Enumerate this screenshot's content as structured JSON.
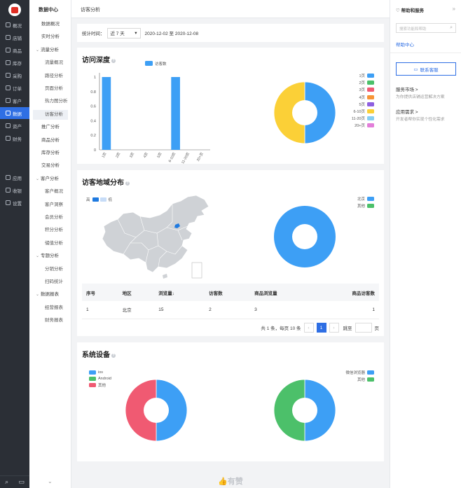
{
  "nav": {
    "items": [
      {
        "label": "概况",
        "icon": "dashboard-icon"
      },
      {
        "label": "店铺",
        "icon": "shop-icon"
      },
      {
        "label": "商品",
        "icon": "tag-icon"
      },
      {
        "label": "库存",
        "icon": "inventory-icon"
      },
      {
        "label": "采购",
        "icon": "purchase-icon"
      },
      {
        "label": "订单",
        "icon": "order-icon"
      },
      {
        "label": "客户",
        "icon": "customer-icon"
      },
      {
        "label": "数据",
        "icon": "chart-icon"
      },
      {
        "label": "资产",
        "icon": "asset-icon"
      },
      {
        "label": "财务",
        "icon": "finance-icon"
      }
    ],
    "items2": [
      {
        "label": "应用",
        "icon": "apps-icon"
      },
      {
        "label": "收银",
        "icon": "cashier-icon"
      },
      {
        "label": "设置",
        "icon": "settings-icon"
      }
    ]
  },
  "submenu": {
    "title": "数据中心",
    "items": [
      {
        "label": "数据概况",
        "type": "lvl1"
      },
      {
        "label": "实时分析",
        "type": "lvl1"
      },
      {
        "label": "流量分析",
        "type": "group"
      },
      {
        "label": "流量概况",
        "type": "lvl2"
      },
      {
        "label": "路径分析",
        "type": "lvl2"
      },
      {
        "label": "页面分析",
        "type": "lvl2"
      },
      {
        "label": "热力图分析",
        "type": "lvl2"
      },
      {
        "label": "访客分析",
        "type": "lvl2"
      },
      {
        "label": "推广分析",
        "type": "lvl1"
      },
      {
        "label": "商品分析",
        "type": "lvl1"
      },
      {
        "label": "库存分析",
        "type": "lvl1"
      },
      {
        "label": "交易分析",
        "type": "lvl1"
      },
      {
        "label": "客户分析",
        "type": "group"
      },
      {
        "label": "客户概况",
        "type": "lvl2"
      },
      {
        "label": "客户洞察",
        "type": "lvl2"
      },
      {
        "label": "会员分析",
        "type": "lvl2"
      },
      {
        "label": "积分分析",
        "type": "lvl2"
      },
      {
        "label": "储值分析",
        "type": "lvl2"
      },
      {
        "label": "专题分析",
        "type": "group"
      },
      {
        "label": "分销分析",
        "type": "lvl2"
      },
      {
        "label": "扫码统计",
        "type": "lvl2"
      },
      {
        "label": "数据报表",
        "type": "group"
      },
      {
        "label": "经营报表",
        "type": "lvl2"
      },
      {
        "label": "财务报表",
        "type": "lvl2"
      }
    ]
  },
  "breadcrumb": "访客分析",
  "filter": {
    "label": "统计时间：",
    "value": "近 7 天",
    "range": "2020-12-02 至 2020-12-08"
  },
  "depth": {
    "title": "访问深度"
  },
  "region": {
    "title": "访客地域分布",
    "map_legend": {
      "high": "高",
      "low": "低"
    },
    "table": {
      "headers": [
        "序号",
        "地区",
        "浏览量↓",
        "访客数",
        "商品浏览量",
        "商品访客数"
      ],
      "rows": [
        [
          "1",
          "北京",
          "15",
          "2",
          "3",
          "1"
        ]
      ]
    },
    "pager": {
      "summary": "共 1 条，每页 10 条",
      "page": "1",
      "jump": "跳至",
      "unit": "页"
    }
  },
  "devices": {
    "title": "系统设备"
  },
  "footer_logo": "有赞",
  "help": {
    "title": "帮助和服务",
    "search_placeholder": "搜索功能和帮助",
    "help_center": "帮助中心",
    "contact": "联系客服",
    "links": [
      {
        "title": "服务市场 >",
        "desc": "为你提供店铺运营解决方案"
      },
      {
        "title": "应用需求 >",
        "desc": "开发者帮你实现个性化需求"
      }
    ]
  },
  "colors": {
    "accent": "#2f6fe4",
    "blue": "#3d9ff5",
    "green": "#4cc06a",
    "red": "#f05a72",
    "orange": "#f79436",
    "purple": "#8e5fe0",
    "yellow": "#fbd037",
    "skyblue": "#86cff2",
    "pink": "#e27ed9"
  },
  "chart_data": [
    {
      "type": "bar",
      "series": [
        {
          "name": "访客数",
          "values": [
            1,
            0,
            0,
            0,
            0,
            1,
            0,
            0
          ]
        }
      ],
      "categories": [
        "1页",
        "2页",
        "3页",
        "4页",
        "5页",
        "6-10页",
        "11-20页",
        "20+页"
      ],
      "yticks": [
        "0",
        "0.2",
        "0.4",
        "0.6",
        "0.8",
        "1"
      ],
      "ylim": [
        0,
        1
      ]
    },
    {
      "type": "pie",
      "labels": [
        "1页",
        "2页",
        "3页",
        "4页",
        "5页",
        "6-10页",
        "11-20页",
        "20+页"
      ],
      "values": [
        1,
        0,
        0,
        0,
        0,
        1,
        0,
        0
      ],
      "colors": [
        "#3d9ff5",
        "#4cc06a",
        "#f05a72",
        "#f79436",
        "#8e5fe0",
        "#fbd037",
        "#86cff2",
        "#e27ed9"
      ]
    },
    {
      "type": "pie",
      "labels": [
        "北京",
        "其他"
      ],
      "values": [
        1,
        0
      ],
      "colors": [
        "#3d9ff5",
        "#4cc06a"
      ]
    },
    {
      "type": "pie",
      "labels": [
        "ios",
        "Android",
        "其他"
      ],
      "values": [
        1,
        0,
        1
      ],
      "colors": [
        "#3d9ff5",
        "#4cc06a",
        "#f05a72"
      ]
    },
    {
      "type": "pie",
      "labels": [
        "微信浏览器",
        "其他"
      ],
      "values": [
        1,
        1
      ],
      "colors": [
        "#3d9ff5",
        "#4cc06a"
      ]
    }
  ]
}
